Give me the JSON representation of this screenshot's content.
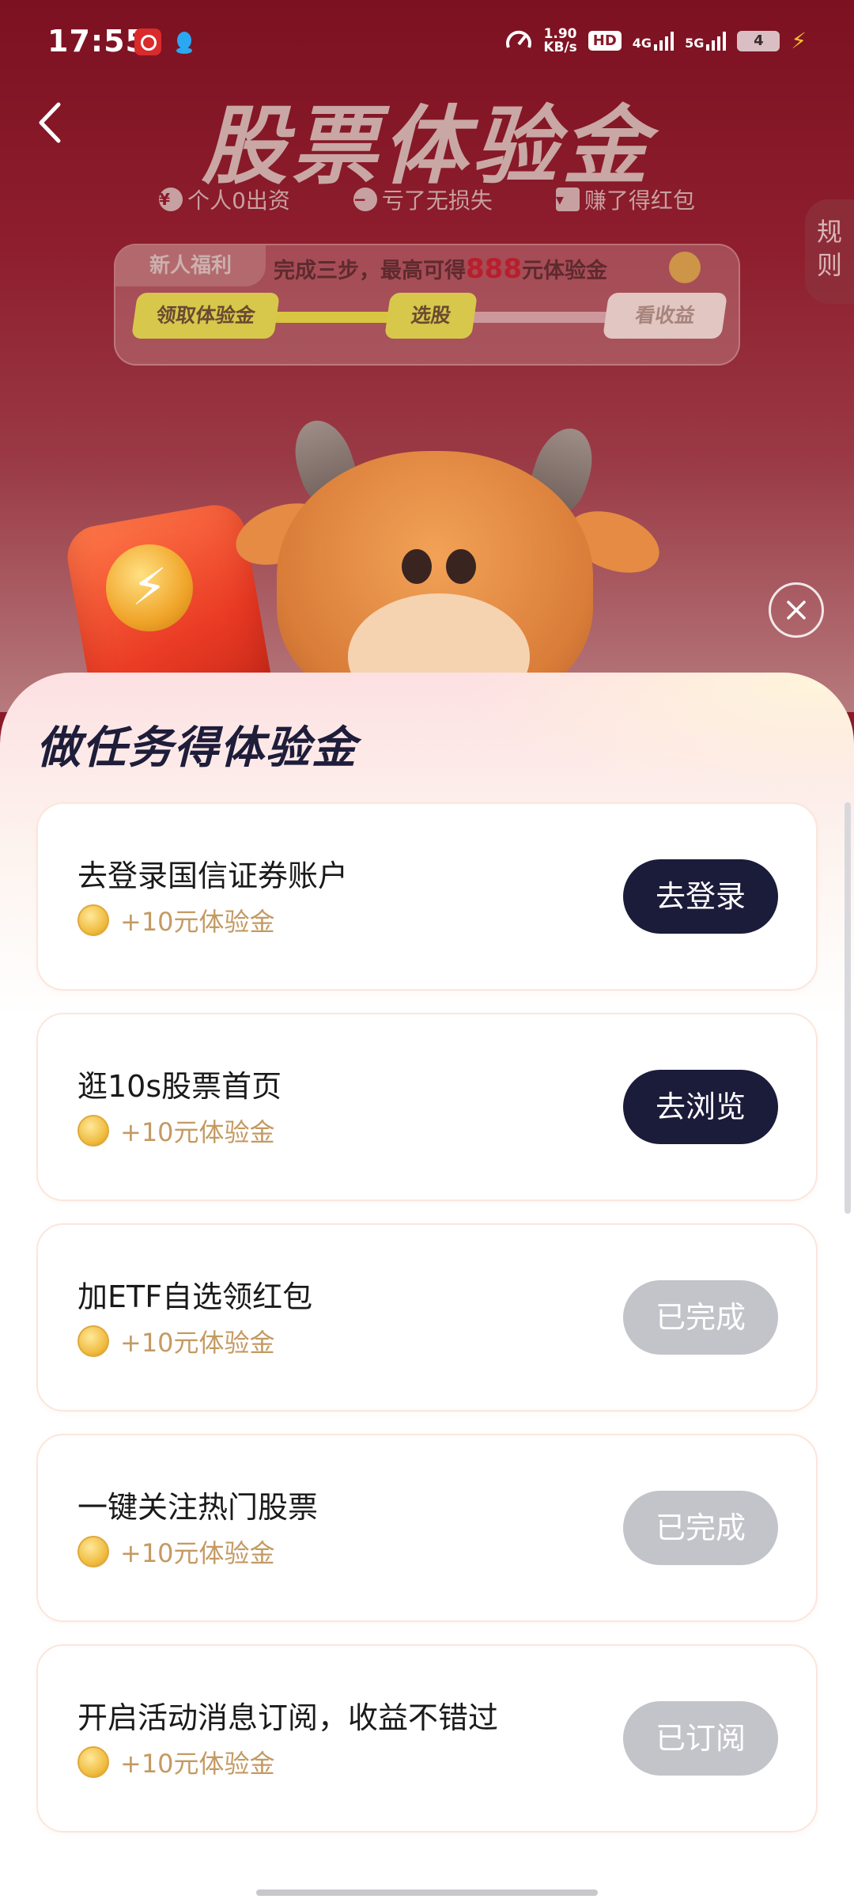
{
  "status_bar": {
    "time": "17:55",
    "speed_value": "1.90",
    "speed_unit": "KB/s",
    "hd_label": "HD",
    "net_4g": "4G",
    "net_5g": "5G",
    "battery": "4"
  },
  "hero": {
    "title": "股票体验金",
    "subtitles": [
      "个人0出资",
      "亏了无损失",
      "赚了得红包"
    ],
    "rules_label": "规则"
  },
  "welfare": {
    "tag": "新人福利",
    "text_prefix": "完成三步，最高可得",
    "amount": "888",
    "text_suffix": "元体验金",
    "steps": [
      "领取体验金",
      "选股",
      "看收益"
    ],
    "progress_fraction": 0.45
  },
  "sheet": {
    "title": "做任务得体验金"
  },
  "tasks": [
    {
      "title": "去登录国信证券账户",
      "reward": "+10元体验金",
      "button": "去登录",
      "state": "active"
    },
    {
      "title": "逛10s股票首页",
      "reward": "+10元体验金",
      "button": "去浏览",
      "state": "active"
    },
    {
      "title": "加ETF自选领红包",
      "reward": "+10元体验金",
      "button": "已完成",
      "state": "done"
    },
    {
      "title": "一键关注热门股票",
      "reward": "+10元体验金",
      "button": "已完成",
      "state": "done"
    },
    {
      "title": "开启活动消息订阅，收益不错过",
      "reward": "+10元体验金",
      "button": "已订阅",
      "state": "done"
    }
  ],
  "colors": {
    "primary_button": "#1b1b3a",
    "done_button": "#c3c3ca",
    "reward_text": "#c49a62",
    "hero_bg": "#8a1a28"
  }
}
